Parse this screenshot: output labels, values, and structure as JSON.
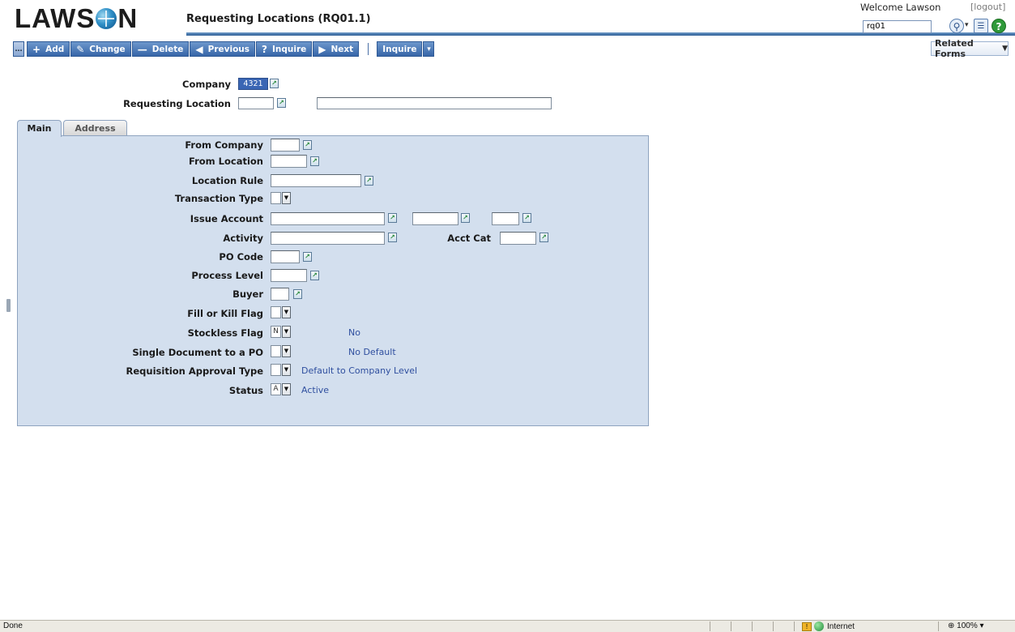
{
  "header": {
    "logo": [
      "LAWS",
      "N"
    ],
    "form_title": "Requesting Locations (RQ01.1)",
    "welcome": "Welcome Lawson",
    "logout": "[logout]",
    "command_value": "rq01"
  },
  "toolbar": {
    "add": "Add",
    "change": "Change",
    "delete": "Delete",
    "previous": "Previous",
    "inquire": "Inquire",
    "next": "Next",
    "inquire2": "Inquire",
    "related_forms": "Related Forms"
  },
  "key": {
    "company_label": "Company",
    "company_value": "4321",
    "req_location_label": "Requesting Location"
  },
  "tabs": {
    "main": "Main",
    "address": "Address"
  },
  "fields": {
    "from_company": "From Company",
    "from_location": "From Location",
    "location_rule": "Location Rule",
    "transaction_type": "Transaction Type",
    "issue_account": "Issue Account",
    "activity": "Activity",
    "acct_cat": "Acct Cat",
    "po_code": "PO Code",
    "process_level": "Process Level",
    "buyer": "Buyer",
    "fill_or_kill": "Fill or Kill Flag",
    "stockless": "Stockless Flag",
    "stockless_value": "N",
    "stockless_desc": "No",
    "single_doc": "Single Document to a PO",
    "single_doc_desc": "No Default",
    "req_approval": "Requisition Approval Type",
    "req_approval_desc": "Default to Company Level",
    "status": "Status",
    "status_value": "A",
    "status_desc": "Active"
  },
  "statusbar": {
    "done": "Done",
    "zone": "Internet",
    "zoom": "100%"
  }
}
